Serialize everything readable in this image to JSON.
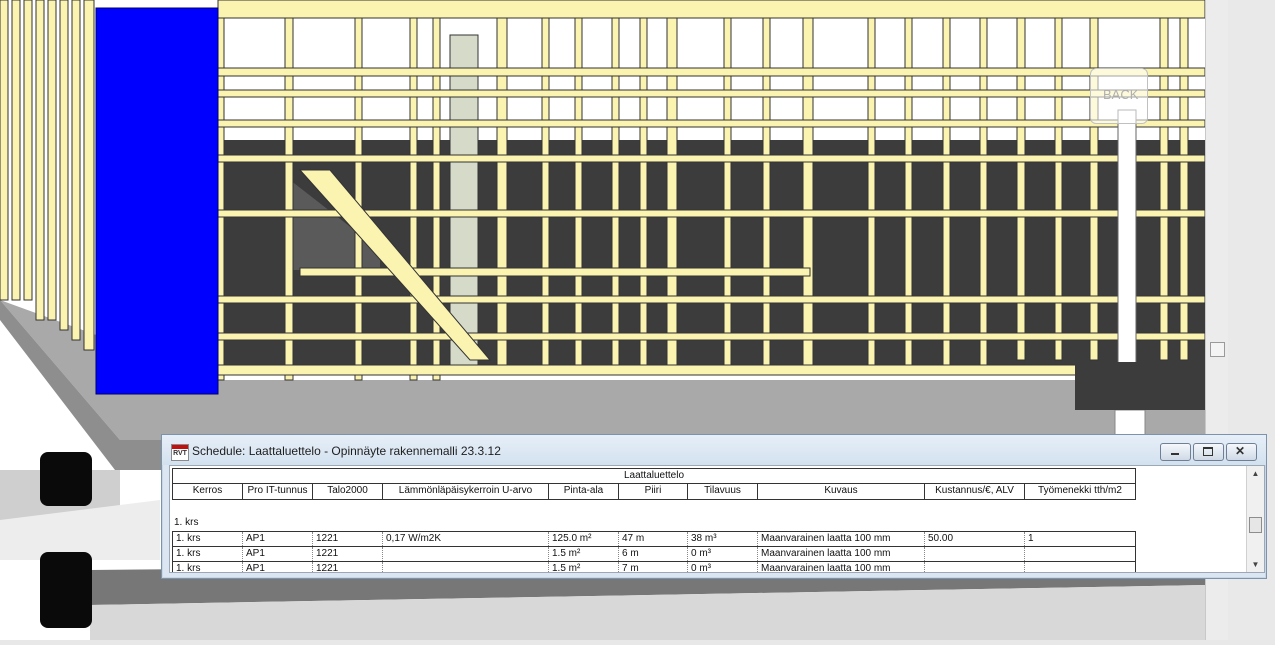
{
  "viewport": {
    "back_label": "BACK"
  },
  "schedule_window": {
    "title": "Schedule: Laattaluettelo - Opinnäyte rakennemalli 23.3.12",
    "icon_text": "RVT",
    "table_title": "Laattaluettelo",
    "columns": [
      "Kerros",
      "Pro IT-tunnus",
      "Talo2000",
      "Lämmönläpäisykerroin U-arvo",
      "Pinta-ala",
      "Piiri",
      "Tilavuus",
      "Kuvaus",
      "Kustannus/€, ALV",
      "Työmenekki tth/m2"
    ],
    "group_label": "1. krs",
    "rows": [
      [
        "1. krs",
        "AP1",
        "1221",
        "0,17 W/m2K",
        "125.0 m²",
        "47 m",
        "38 m³",
        "Maanvarainen laatta 100 mm",
        "50.00",
        "1"
      ],
      [
        "1. krs",
        "AP1",
        "1221",
        "",
        "1.5 m²",
        "6 m",
        "0 m³",
        "Maanvarainen laatta 100 mm",
        "",
        ""
      ],
      [
        "1. krs",
        "AP1",
        "1221",
        "",
        "1.5 m²",
        "7 m",
        "0 m³",
        "Maanvarainen laatta 100 mm",
        "",
        ""
      ]
    ]
  },
  "colors": {
    "timber": "#fbf3b0",
    "slab": "#3c3c3c",
    "selected_element": "#0000ff",
    "floor": "#9d9d9d"
  }
}
